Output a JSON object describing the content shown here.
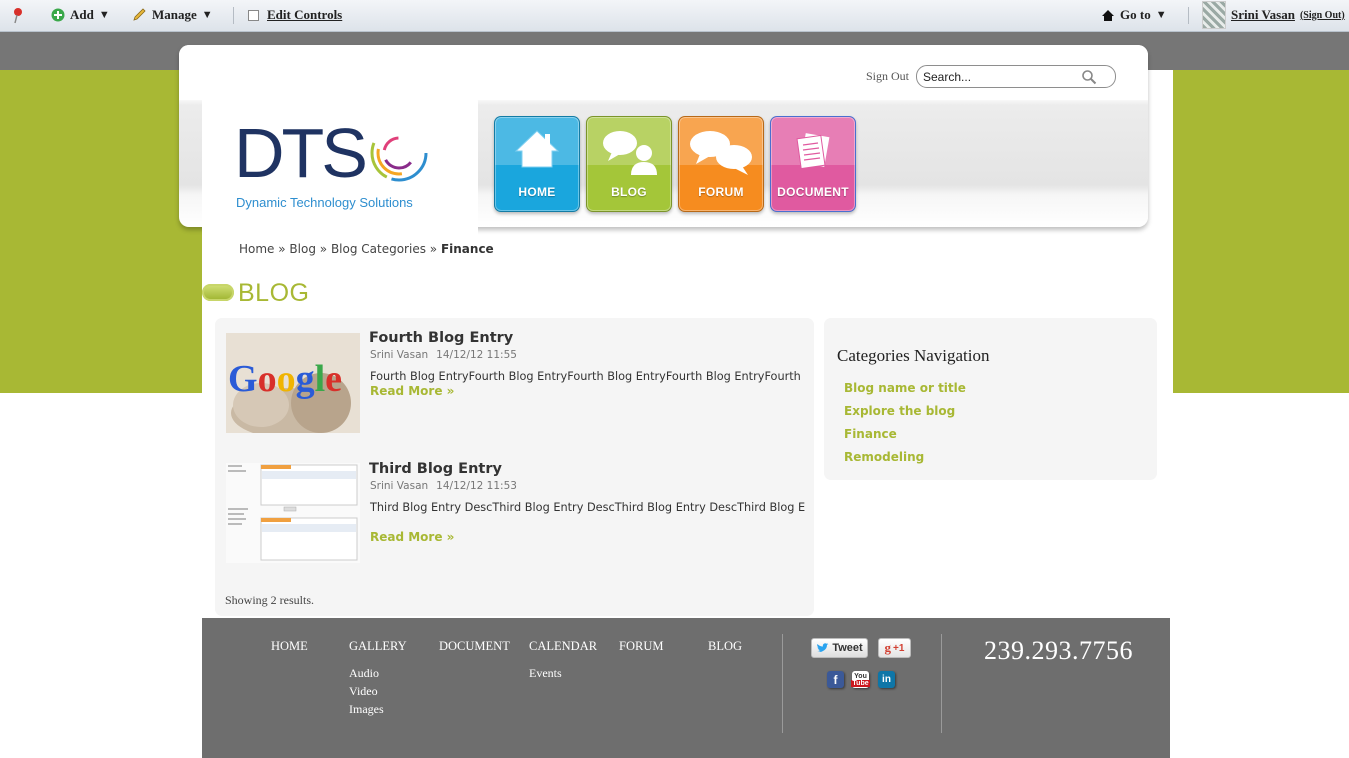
{
  "dockbar": {
    "add_label": "Add",
    "manage_label": "Manage",
    "edit_controls_label": "Edit Controls",
    "goto_label": "Go to",
    "user_name": "Srini Vasan",
    "sign_out_label": "(Sign Out)"
  },
  "header": {
    "sign_out": "Sign Out",
    "search_value": "Search...",
    "logo_text": "DTS",
    "logo_tagline": "Dynamic Technology Solutions"
  },
  "nav": {
    "items": [
      {
        "label": "HOME",
        "icon": "house-icon",
        "color": "#1aa6dd"
      },
      {
        "label": "BLOG",
        "icon": "speech-person-icon",
        "color": "#a4c639"
      },
      {
        "label": "FORUM",
        "icon": "speech-bubbles-icon",
        "color": "#f68c1f"
      },
      {
        "label": "DOCUMENT",
        "icon": "documents-icon",
        "color": "#e05aa0"
      }
    ]
  },
  "breadcrumb": [
    "Home",
    "Blog",
    "Blog Categories",
    "Finance"
  ],
  "page_title": "BLOG",
  "entries": [
    {
      "title": "Fourth Blog Entry",
      "author": "Srini Vasan",
      "date": "14/12/12 11:55",
      "desc": "Fourth Blog EntryFourth Blog EntryFourth Blog EntryFourth Blog EntryFourth",
      "read_more": "Read More »",
      "thumb_text": "Google"
    },
    {
      "title": "Third Blog Entry",
      "author": "Srini Vasan",
      "date": "14/12/12 11:53",
      "desc": "Third Blog Entry DescThird Blog Entry DescThird Blog Entry DescThird Blog E",
      "read_more": "Read More »"
    }
  ],
  "result_count": "Showing 2 results.",
  "categories": {
    "title": "Categories Navigation",
    "items": [
      "Blog name or title",
      "Explore the blog",
      "Finance",
      "Remodeling"
    ]
  },
  "footer": {
    "nav": [
      {
        "label": "HOME",
        "sub": []
      },
      {
        "label": "GALLERY",
        "sub": [
          "Audio",
          "Video",
          "Images"
        ]
      },
      {
        "label": "DOCUMENT",
        "sub": []
      },
      {
        "label": "CALENDAR",
        "sub": [
          "Events"
        ]
      },
      {
        "label": "FORUM",
        "sub": []
      },
      {
        "label": "BLOG",
        "sub": []
      }
    ],
    "tweet_label": "Tweet",
    "plusone_label": "+1",
    "social_icons": [
      "facebook-icon",
      "youtube-icon",
      "linkedin-icon"
    ],
    "phone": "239.293.7756"
  },
  "colors": {
    "accent_green": "#a8b834",
    "band_gray": "#767676",
    "footer_gray": "#6e6e6e",
    "logo_navy": "#1f3362",
    "logo_blue": "#2e8ecf"
  }
}
